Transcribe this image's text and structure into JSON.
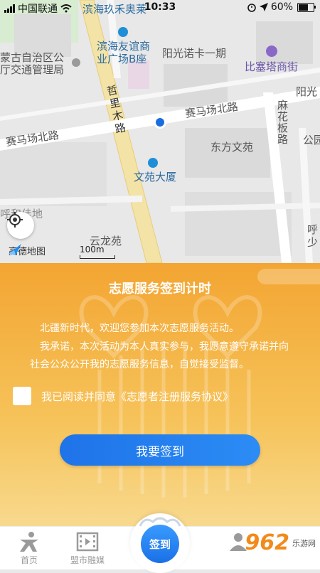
{
  "status_bar": {
    "carrier": "中国联通",
    "time": "10:33",
    "battery": "60%"
  },
  "map": {
    "labels": {
      "binhai_jiuhe": "滨海玖禾奥莱",
      "binhai_youyi": "滨海友谊商",
      "binhai_youyi2": "业广场B座",
      "yangguang_nuoka": "阳光诺卡一期",
      "mongol_traffic1": "蒙古自治区公",
      "mongol_traffic2": "厅交通管理局",
      "bisaita": "比塞塔商街",
      "yangguang": "阳光",
      "saimachang_n1": "赛马场北路",
      "saimachang_n2": "赛马场北路",
      "zhelimu": "哲里木路",
      "mahuaban": "麻花板路",
      "dongfang": "东方文苑",
      "wenyuan": "文苑大厦",
      "gong": "公园",
      "huhe": "呼和佳地",
      "yunlong": "云龙苑",
      "hu_side": "呼",
      "shao_side": "少"
    },
    "brand": "高德地图",
    "scale": "100m"
  },
  "panel": {
    "title": "志愿服务签到计时",
    "paragraph1": "北疆新时代，欢迎您参加本次志愿服务活动。",
    "paragraph2": "我承诺，本次活动为本人真实参与，我愿意遵守承诺并向社会公众公开我的志愿服务信息，自觉接受监督。",
    "agreement": "我已阅读并同意《志愿者注册服务协议》",
    "agreement_checked": false,
    "sign_button": "我要签到"
  },
  "tabbar": {
    "home": "首页",
    "media": "盟市融媒",
    "center": "签到"
  },
  "watermark": {
    "logo": "962",
    "sub": "乐游网"
  },
  "colors": {
    "accent_blue": "#1e73e8",
    "panel_orange": "#f3a532"
  }
}
